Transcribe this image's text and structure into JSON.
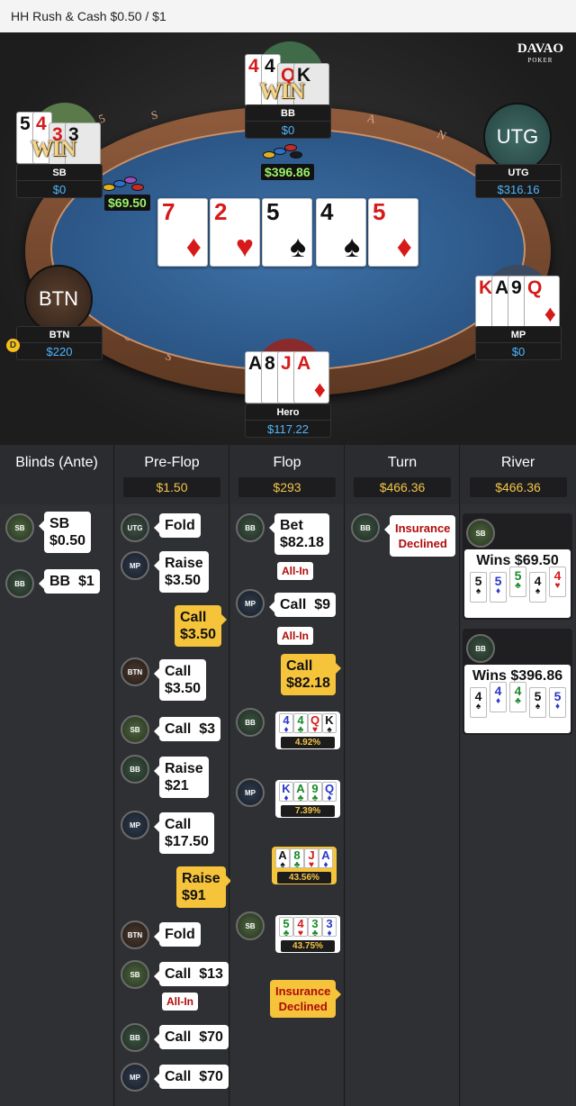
{
  "title": "HH  Rush & Cash $0.50 / $1",
  "logo": {
    "top": "DAVAO",
    "sub": "POKER"
  },
  "rail_text": [
    "5",
    "S",
    "A",
    "N",
    "U",
    "S",
    "A",
    "S"
  ],
  "players": {
    "bb": {
      "name": "BB",
      "stack": "$0",
      "cards": [
        "4",
        "4",
        "Q",
        "K"
      ],
      "win": "WIN"
    },
    "sb": {
      "name": "SB",
      "stack": "$0",
      "cards": [
        "5",
        "4",
        "3",
        "3"
      ],
      "win": "WIN"
    },
    "utg": {
      "avatar": "UTG",
      "name": "UTG",
      "stack": "$316.16"
    },
    "btn": {
      "avatar": "BTN",
      "name": "BTN",
      "stack": "$220",
      "dealer": "D"
    },
    "mp": {
      "name": "MP",
      "stack": "$0",
      "cards": [
        "K",
        "A",
        "9",
        "Q"
      ]
    },
    "hero": {
      "name": "Hero",
      "stack": "$117.22",
      "cards": [
        "A",
        "8",
        "J",
        "A"
      ]
    }
  },
  "pots": {
    "bb_pot": "$396.86",
    "sb_pot": "$69.50"
  },
  "board": [
    {
      "rank": "7",
      "suit": "♦",
      "color": "#d61a1a"
    },
    {
      "rank": "2",
      "suit": "♥",
      "color": "#d61a1a"
    },
    {
      "rank": "5",
      "suit": "♠",
      "color": "#111"
    },
    {
      "rank": "4",
      "suit": "♠",
      "color": "#111"
    },
    {
      "rank": "5",
      "suit": "♦",
      "color": "#d61a1a"
    }
  ],
  "columns": [
    {
      "title": "Blinds (Ante)",
      "pot": ""
    },
    {
      "title": "Pre-Flop",
      "pot": "$1.50"
    },
    {
      "title": "Flop",
      "pot": "$293"
    },
    {
      "title": "Turn",
      "pot": "$466.36"
    },
    {
      "title": "River",
      "pot": "$466.36"
    }
  ],
  "blinds": {
    "sb_label": "SB",
    "sb_text": "SB\n$0.50",
    "bb_label": "BB",
    "bb_text": "BB  $1"
  },
  "preflop": {
    "a1": "UTG",
    "t1": "Fold",
    "a2": "MP",
    "t2": "Raise\n$3.50",
    "h1": "Call\n$3.50",
    "a3": "BTN",
    "t3": "Call\n$3.50",
    "a4": "SB",
    "t4": "Call  $3",
    "a5": "BB",
    "t5": "Raise\n$21",
    "a6": "MP",
    "t6": "Call\n$17.50",
    "h2": "Raise\n$91",
    "a7": "BTN",
    "t7": "Fold",
    "a8": "SB",
    "t8": "Call  $13",
    "allin8": "All-In",
    "a9": "BB",
    "t9": "Call  $70",
    "a10": "MP",
    "t10": "Call  $70"
  },
  "flop": {
    "a1": "BB",
    "t1": "Bet\n$82.18",
    "allin1": "All-In",
    "a2": "MP",
    "t2": "Call  $9",
    "allin2": "All-In",
    "h1": "Call\n$82.18",
    "a3": "BB",
    "eq3": "4.92%",
    "a4": "MP",
    "eq4": "7.39%",
    "eq5": "43.56%",
    "a6": "SB",
    "eq6": "43.75%",
    "h2": "Insurance\nDeclined"
  },
  "turn": {
    "a1": "BB",
    "t1": "Insurance\nDeclined"
  },
  "river": {
    "w1_badge": "SB",
    "w1_text": "Wins $69.50",
    "w2_badge": "BB",
    "w2_text": "Wins $396.86"
  },
  "colors": {
    "accent_yellow": "#f5c43b",
    "stack_blue": "#4fb6ff",
    "pot_green": "#9df26a",
    "felt": "#2b5686"
  }
}
